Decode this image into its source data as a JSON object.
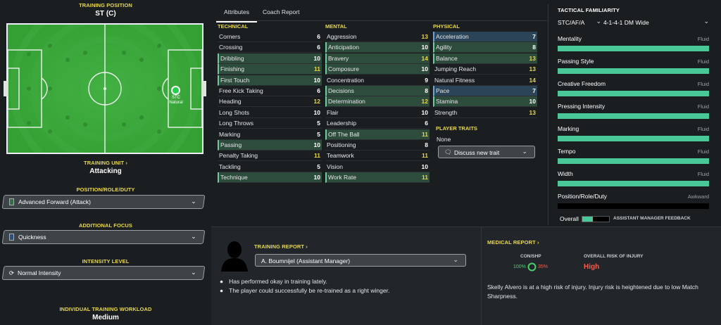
{
  "left": {
    "training_position_label": "TRAINING POSITION",
    "training_position_value": "ST (C)",
    "player_pos_code": "STC",
    "player_pos_sub": "Natural",
    "training_unit_label": "TRAINING UNIT",
    "training_unit_value": "Attacking",
    "position_role_duty_label": "POSITION/ROLE/DUTY",
    "position_role_duty_value": "Advanced Forward (Attack)",
    "additional_focus_label": "ADDITIONAL FOCUS",
    "additional_focus_value": "Quickness",
    "intensity_label": "INTENSITY LEVEL",
    "intensity_value": "Normal Intensity",
    "workload_label": "INDIVIDUAL TRAINING WORKLOAD",
    "workload_value": "Medium",
    "chevron_right": ">"
  },
  "tabs": [
    "Attributes",
    "Coach Report"
  ],
  "technical": {
    "header": "TECHNICAL",
    "items": [
      {
        "name": "Corners",
        "value": "6"
      },
      {
        "name": "Crossing",
        "value": "6"
      },
      {
        "name": "Dribbling",
        "value": "10"
      },
      {
        "name": "Finishing",
        "value": "11"
      },
      {
        "name": "First Touch",
        "value": "10"
      },
      {
        "name": "Free Kick Taking",
        "value": "6"
      },
      {
        "name": "Heading",
        "value": "12"
      },
      {
        "name": "Long Shots",
        "value": "10"
      },
      {
        "name": "Long Throws",
        "value": "5"
      },
      {
        "name": "Marking",
        "value": "5"
      },
      {
        "name": "Passing",
        "value": "10"
      },
      {
        "name": "Penalty Taking",
        "value": "11"
      },
      {
        "name": "Tackling",
        "value": "5"
      },
      {
        "name": "Technique",
        "value": "10"
      }
    ]
  },
  "mental": {
    "header": "MENTAL",
    "items": [
      {
        "name": "Aggression",
        "value": "13"
      },
      {
        "name": "Anticipation",
        "value": "10"
      },
      {
        "name": "Bravery",
        "value": "14"
      },
      {
        "name": "Composure",
        "value": "10"
      },
      {
        "name": "Concentration",
        "value": "9"
      },
      {
        "name": "Decisions",
        "value": "8"
      },
      {
        "name": "Determination",
        "value": "12"
      },
      {
        "name": "Flair",
        "value": "10"
      },
      {
        "name": "Leadership",
        "value": "6"
      },
      {
        "name": "Off The Ball",
        "value": "11"
      },
      {
        "name": "Positioning",
        "value": "8"
      },
      {
        "name": "Teamwork",
        "value": "11"
      },
      {
        "name": "Vision",
        "value": "10"
      },
      {
        "name": "Work Rate",
        "value": "11"
      }
    ]
  },
  "physical": {
    "header": "PHYSICAL",
    "items": [
      {
        "name": "Acceleration",
        "value": "7"
      },
      {
        "name": "Agility",
        "value": "8"
      },
      {
        "name": "Balance",
        "value": "13"
      },
      {
        "name": "Jumping Reach",
        "value": "13"
      },
      {
        "name": "Natural Fitness",
        "value": "14"
      },
      {
        "name": "Pace",
        "value": "7"
      },
      {
        "name": "Stamina",
        "value": "10"
      },
      {
        "name": "Strength",
        "value": "13"
      }
    ]
  },
  "traits": {
    "header": "PLAYER TRAITS",
    "none": "None",
    "discuss": "Discuss new trait"
  },
  "tactical": {
    "header": "TACTICAL FAMILIARITY",
    "position_select": "STC/AF/A",
    "formation_select": "4-1-4-1 DM Wide",
    "rows": [
      {
        "label": "Mentality",
        "status": "Fluid",
        "level": 1.0
      },
      {
        "label": "Passing Style",
        "status": "Fluid",
        "level": 1.0
      },
      {
        "label": "Creative Freedom",
        "status": "Fluid",
        "level": 1.0
      },
      {
        "label": "Pressing Intensity",
        "status": "Fluid",
        "level": 1.0
      },
      {
        "label": "Marking",
        "status": "Fluid",
        "level": 1.0
      },
      {
        "label": "Tempo",
        "status": "Fluid",
        "level": 1.0
      },
      {
        "label": "Width",
        "status": "Fluid",
        "level": 1.0
      },
      {
        "label": "Position/Role/Duty",
        "status": "Awkward",
        "level": 0.0
      }
    ],
    "overall_label": "Overall",
    "overall_level": 0.4,
    "assistant_feedback": "ASSISTANT MANAGER FEEDBACK"
  },
  "training_report": {
    "header": "TRAINING REPORT",
    "coach": "A. Boumnijel (Assistant Manager)",
    "bullets": [
      "Has performed okay in training lately.",
      "The player could successfully be re-trained as a right winger."
    ]
  },
  "medical": {
    "header": "MEDICAL REPORT",
    "con_shp_label": "CON/SHP",
    "condition": "100%",
    "sharpness": "35%",
    "risk_label": "OVERALL RISK OF INJURY",
    "risk_value": "High",
    "text": "Skelly Alvero is at a high risk of injury. Injury risk is heightened due to low Match Sharpness."
  },
  "colors": {
    "yellow": "#e8d84a",
    "green_bar": "#4bc898",
    "risk_red": "#ff5a4a",
    "pitch": "#3aa83a"
  }
}
